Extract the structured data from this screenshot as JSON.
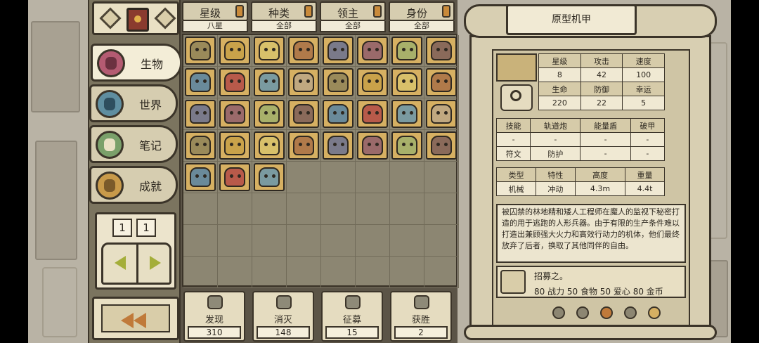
{
  "nav": {
    "items": [
      {
        "label": "生物",
        "active": true,
        "icon": "creature-icon"
      },
      {
        "label": "世界",
        "active": false,
        "icon": "world-icon"
      },
      {
        "label": "笔记",
        "active": false,
        "icon": "notes-icon"
      },
      {
        "label": "成就",
        "active": false,
        "icon": "trophy-icon"
      }
    ],
    "page_left": "1",
    "page_right": "1"
  },
  "filters": [
    {
      "label": "星级",
      "value": "八星"
    },
    {
      "label": "种类",
      "value": "全部"
    },
    {
      "label": "领主",
      "value": "全部"
    },
    {
      "label": "身份",
      "value": "全部"
    }
  ],
  "cards_count": 35,
  "stats": [
    {
      "label": "发现",
      "value": "310"
    },
    {
      "label": "消灭",
      "value": "148"
    },
    {
      "label": "征募",
      "value": "15"
    },
    {
      "label": "获胜",
      "value": "2"
    }
  ],
  "detail": {
    "title": "原型机甲",
    "attr_headers": [
      "星级",
      "攻击",
      "速度"
    ],
    "attr_values": [
      "8",
      "42",
      "100"
    ],
    "attr2_headers": [
      "生命",
      "防御",
      "幸运"
    ],
    "attr2_values": [
      "220",
      "22",
      "5"
    ],
    "skills_header": [
      "技能",
      "轨道炮",
      "能量盾",
      "破甲"
    ],
    "skills_row": [
      "-",
      "-",
      "-",
      "-"
    ],
    "rune_row": [
      "符文",
      "防护",
      "-",
      "-"
    ],
    "info_headers": [
      "类型",
      "特性",
      "高度",
      "重量"
    ],
    "info_values": [
      "机械",
      "冲动",
      "4.3m",
      "4.4t"
    ],
    "description": "被囚禁的林地精和矮人工程师在魔人的监视下秘密打造的用于逃跑的人形兵器。由于有限的生产条件难以打造出兼顾强大火力和高效行动力的机体，他们最终放弃了后者，换取了其他同伴的自由。",
    "recruit_title": "招募之。",
    "recruit_cost": "80 战力 50 食物 50 爱心 80 金币"
  }
}
